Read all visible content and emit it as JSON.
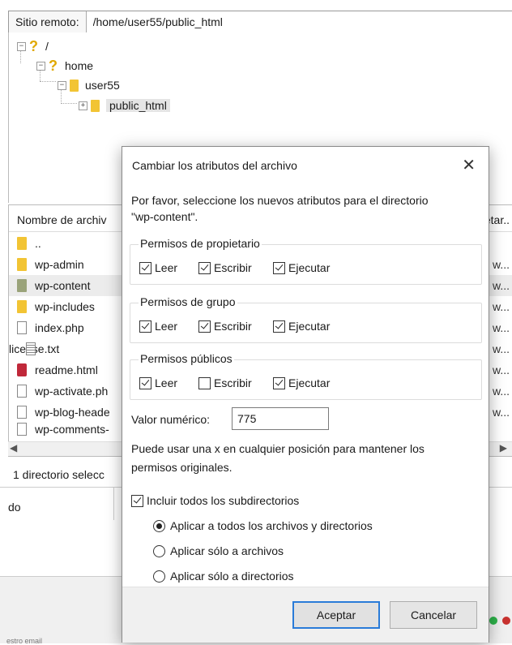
{
  "remote": {
    "label": "Sitio remoto:",
    "path": "/home/user55/public_html"
  },
  "tree": [
    {
      "label": "/",
      "icon": "question-mark-icon",
      "expander": "−"
    },
    {
      "label": "home",
      "icon": "question-mark-icon",
      "expander": "−"
    },
    {
      "label": "user55",
      "icon": "folder-icon",
      "expander": "−"
    },
    {
      "label": "public_html",
      "icon": "folder-icon",
      "expander": "+"
    }
  ],
  "filelist": {
    "header_name": "Nombre de archiv",
    "header_right": "etar..",
    "rows": [
      {
        "name": "..",
        "right": "",
        "icon": "folder-icon"
      },
      {
        "name": "wp-admin",
        "right": "w...",
        "icon": "folder-icon"
      },
      {
        "name": "wp-content",
        "right": "w...",
        "icon": "folder-icon"
      },
      {
        "name": "wp-includes",
        "right": "w...",
        "icon": "folder-icon"
      },
      {
        "name": "index.php",
        "right": "w...",
        "icon": "file-icon"
      },
      {
        "name": "license.txt",
        "right": "w...",
        "icon": "text-file-icon"
      },
      {
        "name": "readme.html",
        "right": "w...",
        "icon": "html-file-icon"
      },
      {
        "name": "wp-activate.ph",
        "right": "w...",
        "icon": "file-icon"
      },
      {
        "name": "wp-blog-heade",
        "right": "w...",
        "icon": "file-icon"
      },
      {
        "name": "wp-comments-",
        "right": "",
        "icon": "file-icon"
      }
    ],
    "status": "1 directorio selecc"
  },
  "queue": {
    "col_label": "do"
  },
  "bottom_tab": "estro email",
  "dialog": {
    "title": "Cambiar los atributos del archivo",
    "close": "✕",
    "intro_line1": "Por favor, seleccione los nuevos atributos para el directorio",
    "intro_line2": "\"wp-content\".",
    "groups": [
      {
        "title": "Permisos de propietario",
        "read": "Leer",
        "write": "Escribir",
        "exec": "Ejecutar",
        "read_on": true,
        "write_on": true,
        "exec_on": true
      },
      {
        "title": "Permisos de grupo",
        "read": "Leer",
        "write": "Escribir",
        "exec": "Ejecutar",
        "read_on": true,
        "write_on": true,
        "exec_on": true
      },
      {
        "title": "Permisos públicos",
        "read": "Leer",
        "write": "Escribir",
        "exec": "Ejecutar",
        "read_on": true,
        "write_on": false,
        "exec_on": true
      }
    ],
    "numeric_label": "Valor numérico:",
    "numeric_value": "775",
    "hint_line1": "Puede usar una x en cualquier posición para mantener los",
    "hint_line2": "permisos originales.",
    "recurse_label": "Incluir todos los subdirectorios",
    "recurse_on": true,
    "radio_all": "Aplicar a todos los archivos y directorios",
    "radio_files": "Aplicar sólo a archivos",
    "radio_dirs": "Aplicar sólo a directorios",
    "ok": "Aceptar",
    "cancel": "Cancelar"
  }
}
